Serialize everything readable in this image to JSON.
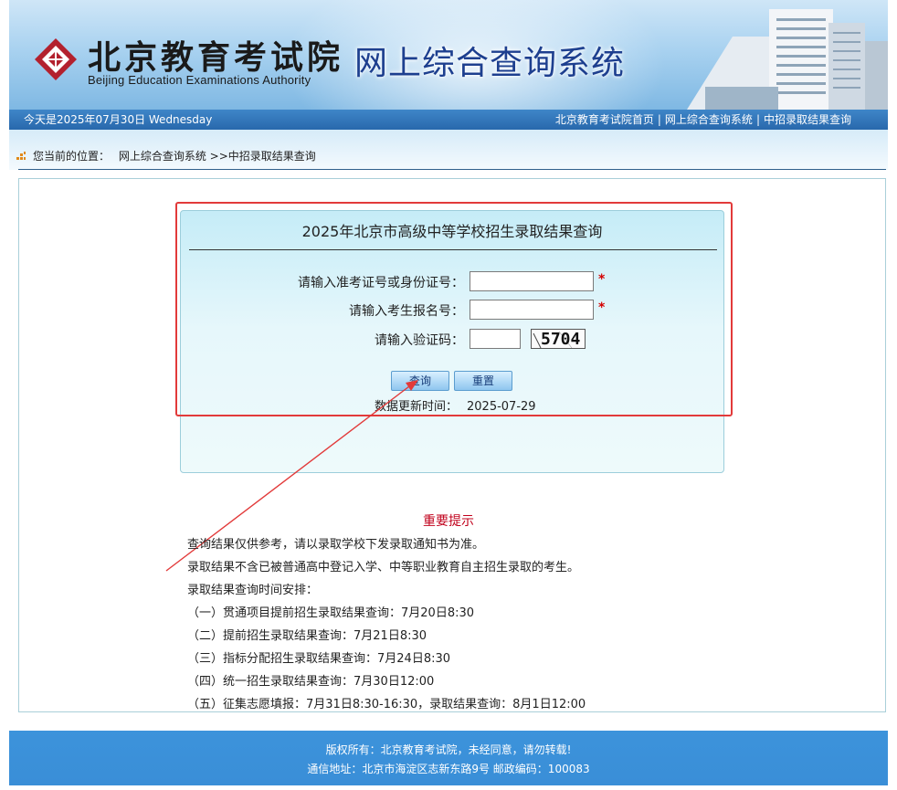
{
  "header": {
    "org_cn": "北京教育考试院",
    "org_en": "Beijing Education Examinations Authority",
    "system_title": "网上综合查询系统",
    "colors": {
      "nav": "#2e6fb3",
      "footer": "#3a90d9",
      "title": "#1d3f8f"
    }
  },
  "navbar": {
    "date": "今天是2025年07月30日 Wednesday",
    "links": [
      "北京教育考试院首页",
      "网上综合查询系统",
      "中招录取结果查询"
    ],
    "separator": "|"
  },
  "breadcrumb": {
    "prefix": "您当前的位置：",
    "path": "网上综合查询系统 >>中招录取结果查询"
  },
  "form": {
    "title": "2025年北京市高级中等学校招生录取结果查询",
    "id_label": "请输入准考证号或身份证号：",
    "id_value": "",
    "reg_label": "请输入考生报名号：",
    "reg_value": "",
    "captcha_label": "请输入验证码：",
    "captcha_value": "",
    "captcha_image_text": "5704",
    "required_mark": "*",
    "query_button": "查询",
    "reset_button": "重置",
    "update_label": "数据更新时间：",
    "update_value": "2025-07-29"
  },
  "notice": {
    "title": "重要提示",
    "lines": [
      "查询结果仅供参考，请以录取学校下发录取通知书为准。",
      "录取结果不含已被普通高中登记入学、中等职业教育自主招生录取的考生。",
      "录取结果查询时间安排：",
      "（一）贯通项目提前招生录取结果查询：7月20日8:30",
      "（二）提前招生录取结果查询：7月21日8:30",
      "（三）指标分配招生录取结果查询：7月24日8:30",
      "（四）统一招生录取结果查询：7月30日12:00",
      "（五）征集志愿填报：7月31日8:30-16:30，录取结果查询：8月1日12:00"
    ]
  },
  "footer": {
    "copyright": "版权所有：北京教育考试院，未经同意，请勿转载!",
    "address": "通信地址：北京市海淀区志新东路9号 邮政编码：100083"
  }
}
